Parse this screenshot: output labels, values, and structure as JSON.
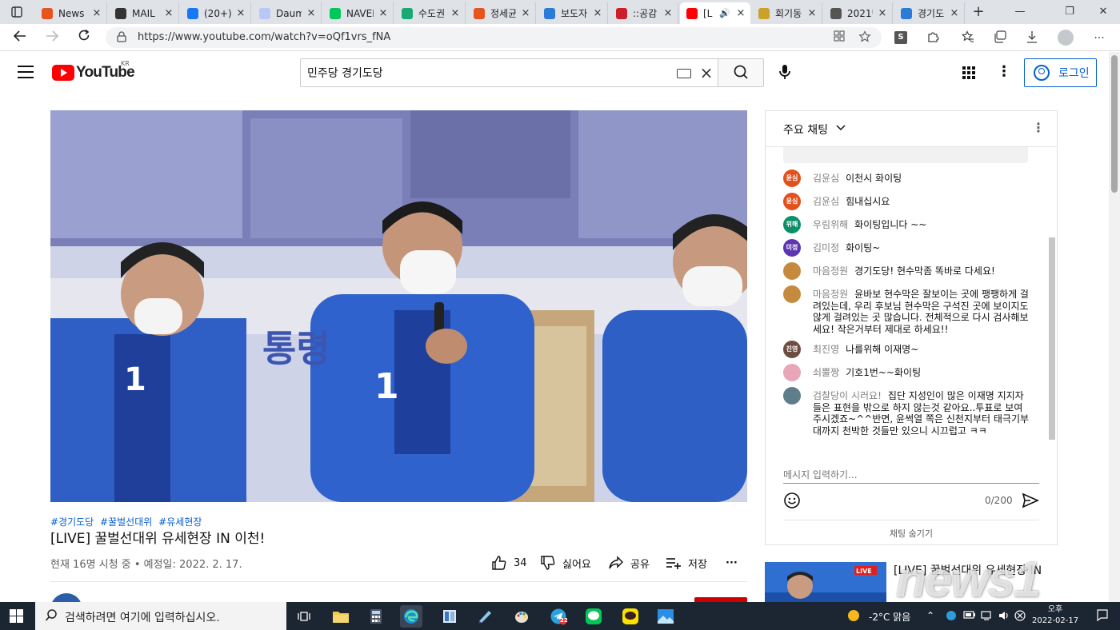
{
  "browser": {
    "tabs": [
      {
        "label": "News",
        "favicon": "red",
        "favicon_color": "#e8541e"
      },
      {
        "label": "MAIL",
        "favicon": "gmail",
        "favicon_color": "#333333"
      },
      {
        "label": "(20+)",
        "favicon": "facebook",
        "favicon_color": "#1877f2"
      },
      {
        "label": "Daum",
        "favicon": "daum",
        "favicon_color": "#b9c7f5"
      },
      {
        "label": "NAVER",
        "favicon": "naver",
        "favicon_color": "#03c75a"
      },
      {
        "label": "수도권",
        "favicon": "green-circle",
        "favicon_color": "#19a974"
      },
      {
        "label": "정세균",
        "favicon": "red",
        "favicon_color": "#e8541e"
      },
      {
        "label": "보도자",
        "favicon": "blue-wave",
        "favicon_color": "#2b7bd8"
      },
      {
        "label": "::공감",
        "favicon": "n-red",
        "favicon_color": "#cc1f2b"
      },
      {
        "label": "[L",
        "favicon": "youtube",
        "favicon_color": "#ff0000",
        "active": true
      },
      {
        "label": "회기동",
        "favicon": "smiley",
        "favicon_color": "#c9a227"
      },
      {
        "label": "2021년",
        "favicon": "document",
        "favicon_color": "#555555"
      },
      {
        "label": "경기도",
        "favicon": "blue-wave",
        "favicon_color": "#2b7bd8"
      }
    ],
    "url": "https://www.youtube.com/watch?v=oQf1vrs_fNA"
  },
  "youtube": {
    "logo_text": "YouTube",
    "region": "KR",
    "search_value": "민주당 경기도당",
    "login_label": "로그인"
  },
  "video": {
    "overlay_text": "통령",
    "vest_number": "1",
    "hashtags": [
      "#경기도당",
      "#꿀벌선대위",
      "#유세현장"
    ],
    "title": "[LIVE] 꿀벌선대위 유세현장 IN 이천!",
    "meta": "현재 16명 시청 중 • 예정일: 2022. 2. 17.",
    "likes": "34",
    "dislike_label": "싫어요",
    "share_label": "공유",
    "save_label": "저장",
    "more_label": "···"
  },
  "chat": {
    "title": "주요 채팅",
    "messages": [
      {
        "author": "김윤심",
        "text": "이천시 화이팅",
        "avatar_text": "윤심",
        "avatar_color": "#e2501b"
      },
      {
        "author": "김윤심",
        "text": "힘내십시요",
        "avatar_text": "윤심",
        "avatar_color": "#e2501b"
      },
      {
        "author": "우림위해",
        "text": "화이팅입니다 ~~",
        "avatar_text": "위해",
        "avatar_color": "#0b8f6a"
      },
      {
        "author": "김미정",
        "text": "화이팅~",
        "avatar_text": "미정",
        "avatar_color": "#5e35b1"
      },
      {
        "author": "마음정원",
        "text": "경기도당! 현수막좀 똑바로 다세요!",
        "avatar_text": "",
        "avatar_color": "#c58a3e"
      },
      {
        "author": "마음정원",
        "text": "윤바보 현수막은 잘보이는 곳에 팽팽하게 걸려있는데, 우리 후보님 현수막은 구석진 곳에 보이지도 않게 걸려있는 곳 많습니다. 전체적으로 다시 검사해보세요! 작은거부터 제대로 하세요!!",
        "avatar_text": "",
        "avatar_color": "#c58a3e"
      },
      {
        "author": "최진영",
        "text": "나를위해 이재명~",
        "avatar_text": "진영",
        "avatar_color": "#6d4c41"
      },
      {
        "author": "쇠뿔짱",
        "text": "기호1번~~화이팅",
        "avatar_text": "",
        "avatar_color": "#e8a6b8"
      },
      {
        "author": "검찰당이 시러요!",
        "text": "집단 지성인이 많은 이재명 지지자들은 표현을 밖으로 하지 않는것 같아요..투표로 보여주시겠죠~^^반면, 윤썩열 쪽은 신천지부터 태극기부대까지 천박한 것들만 있으니 시끄럽고 ㅋㅋ",
        "avatar_text": "",
        "avatar_color": "#607d8b"
      }
    ],
    "input_placeholder": "메시지 입력하기...",
    "char_count": "0/200",
    "hide_chat_label": "채팅 숨기기"
  },
  "related": {
    "title": "[LIVE] 꿀벌선대위 유세현장 IN",
    "badge": "LIVE"
  },
  "watermark": "news1",
  "taskbar": {
    "search_placeholder": "검색하려면 여기에 입력하십시오.",
    "weather": "-2°C 맑음",
    "date": "2022-02-17",
    "time": "오후",
    "telegram_badge": "22"
  }
}
